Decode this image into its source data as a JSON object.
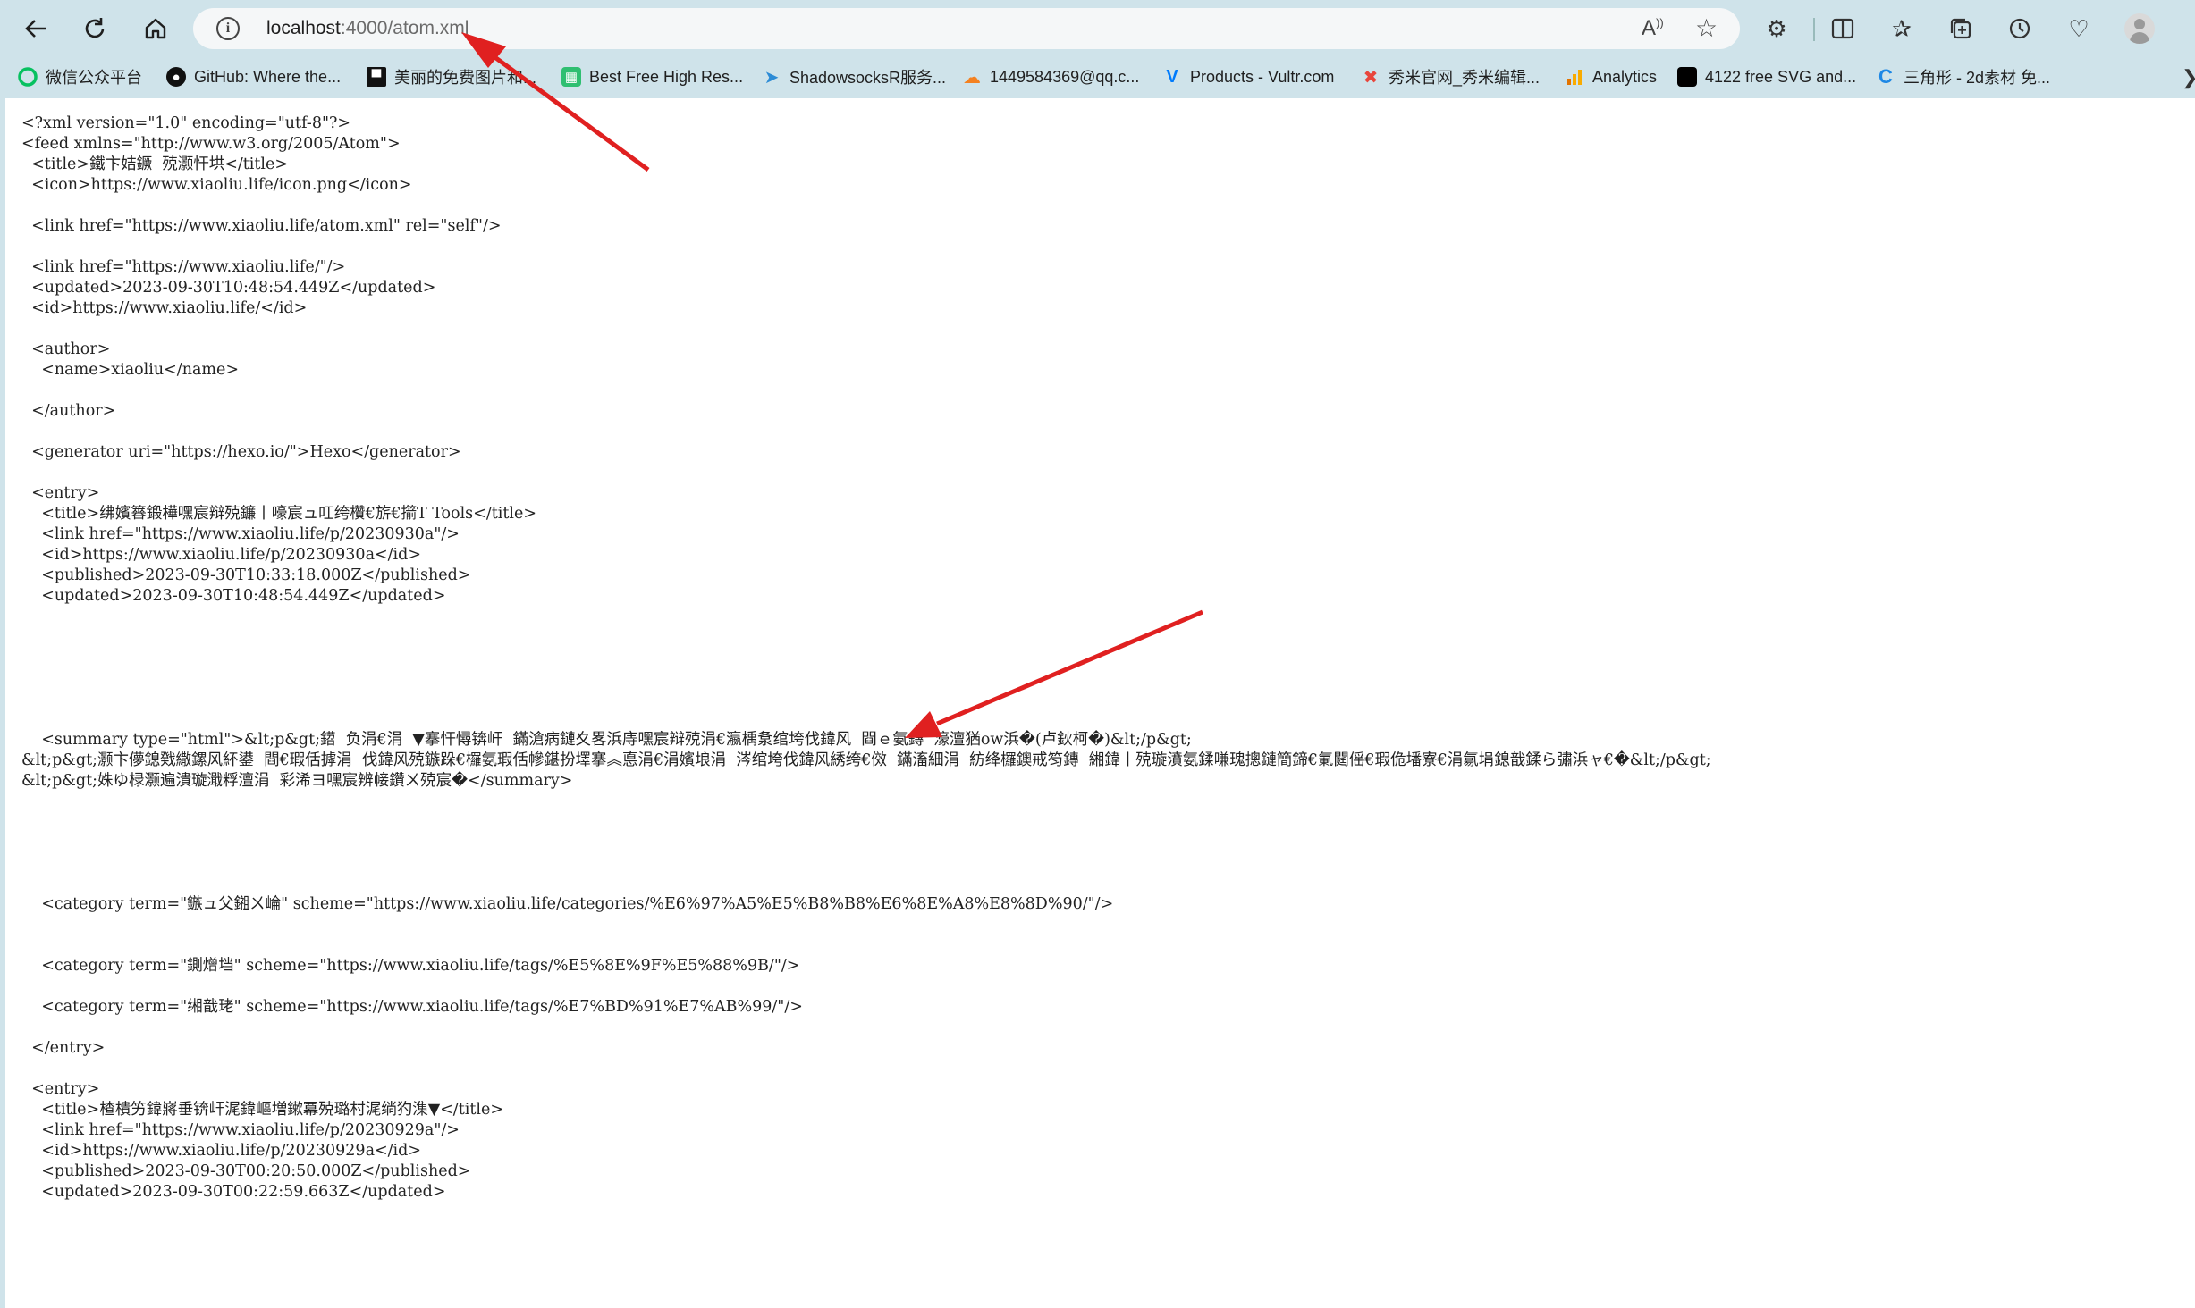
{
  "browser": {
    "url_host": "localhost",
    "url_rest": ":4000/atom.xml",
    "back_icon": "back-arrow-icon",
    "reload_icon": "reload-icon",
    "home_icon": "home-icon"
  },
  "bookmarks": [
    {
      "label": "微信公众平台",
      "icon": "wechat-icon",
      "color": "#07c160"
    },
    {
      "label": "GitHub: Where the...",
      "icon": "github-icon",
      "color": "#111111"
    },
    {
      "label": "美丽的免费图片和...",
      "icon": "unsplash-icon",
      "color": "#111111"
    },
    {
      "label": "Best Free High Res...",
      "icon": "bookmark-green-icon",
      "color": "#2fbf71"
    },
    {
      "label": "ShadowsocksR服务...",
      "icon": "paper-plane-icon",
      "color": "#2d8cd6"
    },
    {
      "label": "1449584369@qq.c...",
      "icon": "cloud-icon",
      "color": "#f48120"
    },
    {
      "label": "Products - Vultr.com",
      "icon": "vultr-icon",
      "color": "#007bfc"
    },
    {
      "label": "秀米官网_秀米编辑...",
      "icon": "xiumi-icon",
      "color": "#e8463c"
    },
    {
      "label": "Analytics",
      "icon": "analytics-icon",
      "color": "#f9ab00"
    },
    {
      "label": "4122 free SVG and...",
      "icon": "svg-black-icon",
      "color": "#000000"
    },
    {
      "label": "三角形 - 2d素材 免...",
      "icon": "c-logo-icon",
      "color": "#1e88e5"
    }
  ],
  "xml_lines": [
    "<?xml version=\"1.0\" encoding=\"utf-8\"?>",
    "<feed xmlns=\"http://www.w3.org/2005/Atom\">",
    "  <title>鐵卞姞鐝  殑灏忓垬</title>",
    "  <icon>https://www.xiaoliu.life/icon.png</icon>",
    "",
    "  <link href=\"https://www.xiaoliu.life/atom.xml\" rel=\"self\"/>",
    "",
    "  <link href=\"https://www.xiaoliu.life/\"/>",
    "  <updated>2023-09-30T10:48:54.449Z</updated>",
    "  <id>https://www.xiaoliu.life/</id>",
    "",
    "  <author>",
    "    <name>xiaoliu</name>",
    "",
    "  </author>",
    "",
    "  <generator uri=\"https://hexo.io/\">Hexo</generator>",
    "",
    "  <entry>",
    "    <title>绋嬪簭鍛樺嘿宸辩殑鐮丨嚎宸ュ叿绔欑€旂€擶T Tools</title>",
    "    <link href=\"https://www.xiaoliu.life/p/20230930a\"/>",
    "    <id>https://www.xiaoliu.life/p/20230930a</id>",
    "    <published>2023-09-30T10:33:18.000Z</published>",
    "    <updated>2023-09-30T10:48:54.449Z</updated>",
    "",
    "",
    "",
    "",
    "",
    "",
    "    <summary type=\"html\">&lt;p&gt;鍣  负涓€涓  ▼搴忓憳锛屽  鏋滄病鏈夊畧浜庤嘿宸辩殑涓€瀛楀洜绾垮伐鍏风  閰ｅ氨鏄  濠澶猶ow浜�(卢鈥柯�)&lt;/p&gt;",
    "&lt;p&gt;灏卞儚鎴戣繖鏍风紑鍙  閰€瑕佸摢涓  伐鍏风殑鏃跺€欏氨瑕佸幓鍖扮墿搴︽悳涓€涓嬪埌涓  涔绾垮伐鍏风綉绔€傚  鏋滀細涓  紡绛欏鐭戒笉鏄  緗鍏丨殑璇濆氨鍒嗛瑰摠鏈簡鍗€氭閮傜€瑕佹墦寮€涓氱埍鎴戠鍒ら彇浜ャ€�&lt;/p&gt;",
    "&lt;p&gt;姝ゆ椂灏遍潰璇濈粰澶涓  彩浠ヨ嘿宸辨帹鑽ㄨ殑宸�</summary>",
    "",
    "",
    "",
    "",
    "",
    "    <category term=\"鏃ュ父鎺ㄨ崘\" scheme=\"https://www.xiaoliu.life/categories/%E6%97%A5%E5%B8%B8%E6%8E%A8%E8%8D%90/\"/>",
    "",
    "",
    "    <category term=\"鍘熷垱\" scheme=\"https://www.xiaoliu.life/tags/%E5%8E%9F%E5%88%9B/\"/>",
    "",
    "    <category term=\"缃戠珯\" scheme=\"https://www.xiaoliu.life/tags/%E7%BD%91%E7%AB%99/\"/>",
    "",
    "  </entry>",
    "",
    "  <entry>",
    "    <title>楂樻竻鍏嶈垂锛屽浘鍏嶇増鏉冪殑璐村浘绱犳潗▼</title>",
    "    <link href=\"https://www.xiaoliu.life/p/20230929a\"/>",
    "    <id>https://www.xiaoliu.life/p/20230929a</id>",
    "    <published>2023-09-30T00:20:50.000Z</published>",
    "    <updated>2023-09-30T00:22:59.663Z</updated>"
  ],
  "annotation_color": "#e02020"
}
